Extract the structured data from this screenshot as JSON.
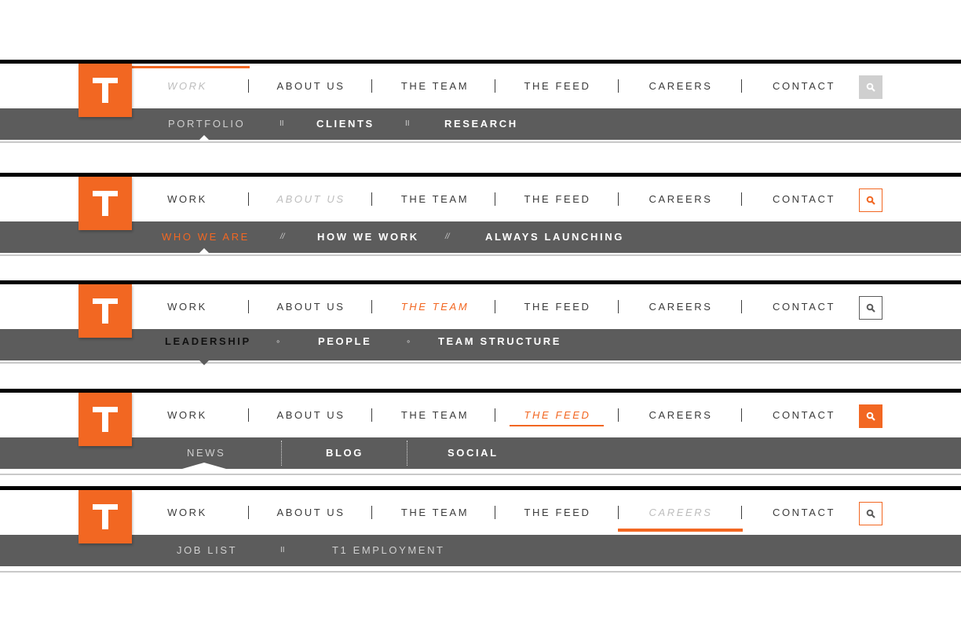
{
  "colors": {
    "accent": "#f26722",
    "subnav_bg": "#5c5c5c",
    "text": "#3b3b3b",
    "inactive": "#bdbdbd"
  },
  "logo": {
    "letter": "T"
  },
  "main_nav": [
    "WORK",
    "ABOUT US",
    "THE TEAM",
    "THE FEED",
    "CAREERS",
    "CONTACT"
  ],
  "variants": [
    {
      "active_item": "WORK",
      "search_style": "gray-filled",
      "subnav": [
        "PORTFOLIO",
        "CLIENTS",
        "RESEARCH"
      ],
      "subnav_separator": "II"
    },
    {
      "active_item": "ABOUT US",
      "search_style": "orange-outline",
      "subnav": [
        "WHO WE ARE",
        "HOW WE WORK",
        "ALWAYS LAUNCHING"
      ],
      "subnav_separator": "//"
    },
    {
      "active_item": "THE TEAM",
      "search_style": "gray-outline",
      "subnav": [
        "LEADERSHIP",
        "PEOPLE",
        "TEAM STRUCTURE"
      ],
      "subnav_separator": "∘"
    },
    {
      "active_item": "THE FEED",
      "search_style": "orange-filled",
      "subnav": [
        "NEWS",
        "BLOG",
        "SOCIAL"
      ],
      "subnav_separator": "dotted-line"
    },
    {
      "active_item": "CAREERS",
      "search_style": "orange-outline",
      "subnav": [
        "JOB LIST",
        "T1 EMPLOYMENT"
      ],
      "subnav_separator": "II"
    }
  ]
}
